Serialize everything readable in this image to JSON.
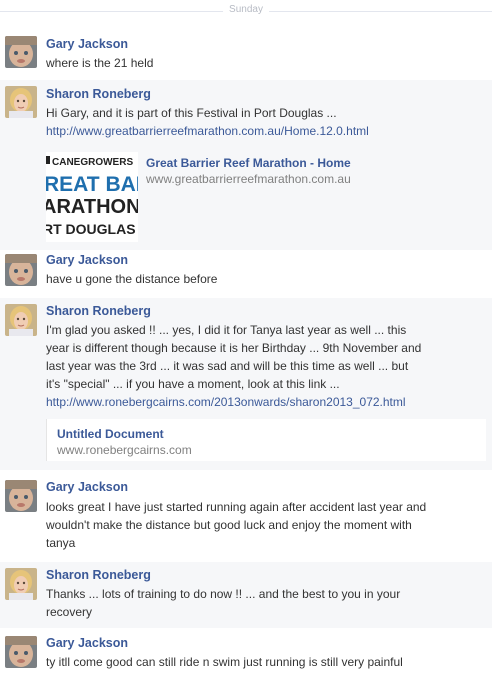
{
  "date_separator": "Sunday",
  "messages": [
    {
      "name": "Gary Jackson",
      "text": "where is the 21 held"
    },
    {
      "name": "Sharon Roneberg",
      "text": "Hi Gary, and it is part of this Festival in Port Douglas ...",
      "link": "http://www.greatbarrierreefmarathon.com.au/Home.12.0.html",
      "share": {
        "title": "Great Barrier Reef Marathon - Home",
        "domain": "www.greatbarrierreefmarathon.com.au",
        "thumb": {
          "brand": "CANEGROWERS",
          "line1": "REAT BARI",
          "line2": "ARATHON",
          "line3": "RT DOUGLAS"
        }
      }
    },
    {
      "name": "Gary Jackson",
      "text": "have u gone the distance before"
    },
    {
      "name": "Sharon Roneberg",
      "lines": [
        "I'm glad you asked !! ... yes, I did it for Tanya last year as well ... this",
        "year is different though because it is her Birthday ... 9th November and",
        "last year was the 3rd ... it was sad and will be this time as well ... but",
        "it's \"special\" ... if you have a moment, look at this link ..."
      ],
      "link": "http://www.ronebergcairns.com/2013onwards/sharon2013_072.html",
      "share": {
        "title": "Untitled Document",
        "domain": "www.ronebergcairns.com"
      }
    },
    {
      "name": "Gary Jackson",
      "lines": [
        "looks great I have just started running again after accident last year and",
        "wouldn't make the distance but good luck and enjoy the moment with",
        "tanya"
      ]
    },
    {
      "name": "Sharon Roneberg",
      "lines": [
        "Thanks ... lots of training to do now !! ... and the best to you in your",
        "recovery"
      ]
    },
    {
      "name": "Gary Jackson",
      "text": "ty itll come good can still ride n swim just running is still very painful"
    }
  ],
  "colors": {
    "name": "#3b5998",
    "text": "#333333",
    "domain": "#808080",
    "separator": "#b8bcc5",
    "alt_bg": "#f6f7f9"
  }
}
